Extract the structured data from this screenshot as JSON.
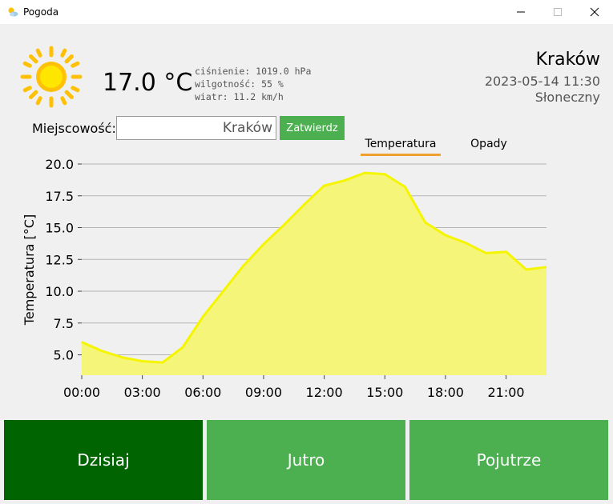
{
  "window": {
    "title": "Pogoda"
  },
  "current": {
    "temperature": "17.0 °C",
    "pressure": "ciśnienie: 1019.0 hPa",
    "humidity": "wilgotność: 55 %",
    "wind": "wiatr: 11.2 km/h",
    "city": "Kraków",
    "datetime": "2023-05-14 11:30",
    "condition": "Słoneczny"
  },
  "location": {
    "label": "Miejscowość:",
    "value": "Kraków",
    "submit_label": "Zatwierdz"
  },
  "tabs": [
    {
      "label": "Temperatura"
    },
    {
      "label": "Opady"
    }
  ],
  "days": [
    {
      "label": "Dzisiaj"
    },
    {
      "label": "Jutro"
    },
    {
      "label": "Pojutrze"
    }
  ],
  "colors": {
    "accent_dark": "#006400",
    "accent": "#4caf50",
    "tab_underline": "#f0a030",
    "line": "#f5f500",
    "fill": "#f5f57a",
    "sun": "#ffd700"
  },
  "chart_data": {
    "type": "area",
    "ylabel": "Temperatura [°C]",
    "ylim": [
      3.4,
      20.0
    ],
    "yticks": [
      "5.0",
      "7.5",
      "10.0",
      "12.5",
      "15.0",
      "17.5",
      "20.0"
    ],
    "xticks": [
      "00:00",
      "03:00",
      "06:00",
      "09:00",
      "12:00",
      "15:00",
      "18:00",
      "21:00"
    ],
    "x": [
      0,
      1,
      2,
      3,
      4,
      5,
      6,
      7,
      8,
      9,
      10,
      11,
      12,
      13,
      14,
      15,
      16,
      17,
      18,
      19,
      20,
      21,
      22,
      23
    ],
    "values": [
      6.0,
      5.3,
      4.8,
      4.5,
      4.4,
      5.6,
      8.0,
      10.0,
      12.0,
      13.7,
      15.2,
      16.8,
      18.3,
      18.7,
      19.3,
      19.2,
      18.2,
      15.4,
      14.4,
      13.8,
      13.0,
      13.1,
      11.7,
      11.9
    ]
  }
}
